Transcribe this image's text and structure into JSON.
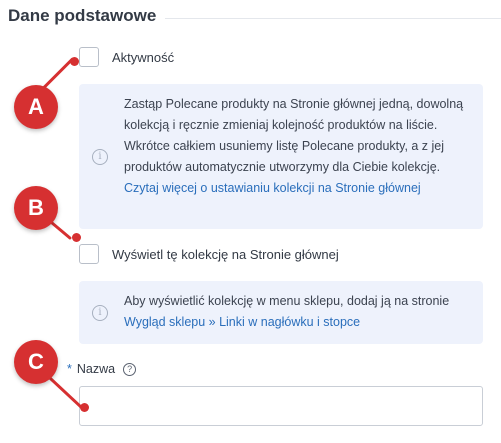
{
  "section": {
    "title": "Dane podstawowe"
  },
  "active_checkbox": {
    "label": "Aktywność",
    "checked": false
  },
  "info_box_1": {
    "text": "Zastąp Polecane produkty na Stronie głównej jedną, dowolną kolekcją i ręcznie zmieniaj kolejność produktów na liście. Wkrótce całkiem usuniemy listę Polecane produkty, a z jej produktów automatycznie utworzymy dla Ciebie kolekcję.",
    "link": "Czytaj więcej o ustawianiu kolekcji na Stronie głównej"
  },
  "homepage_checkbox": {
    "label": "Wyświetl tę kolekcję na Stronie głównej",
    "checked": false
  },
  "info_box_2": {
    "text": "Aby wyświetlić kolekcję w menu sklepu, dodaj ją na stronie",
    "link": "Wygląd sklepu » Linki w nagłówku i stopce"
  },
  "name_field": {
    "required_marker": "*",
    "label": "Nazwa",
    "help": "?",
    "value": ""
  },
  "annotations": {
    "a": "A",
    "b": "B",
    "c": "C",
    "color": "#d63031"
  },
  "colors": {
    "accent": "#2a6ebb",
    "info_bg": "#eef2fc"
  }
}
